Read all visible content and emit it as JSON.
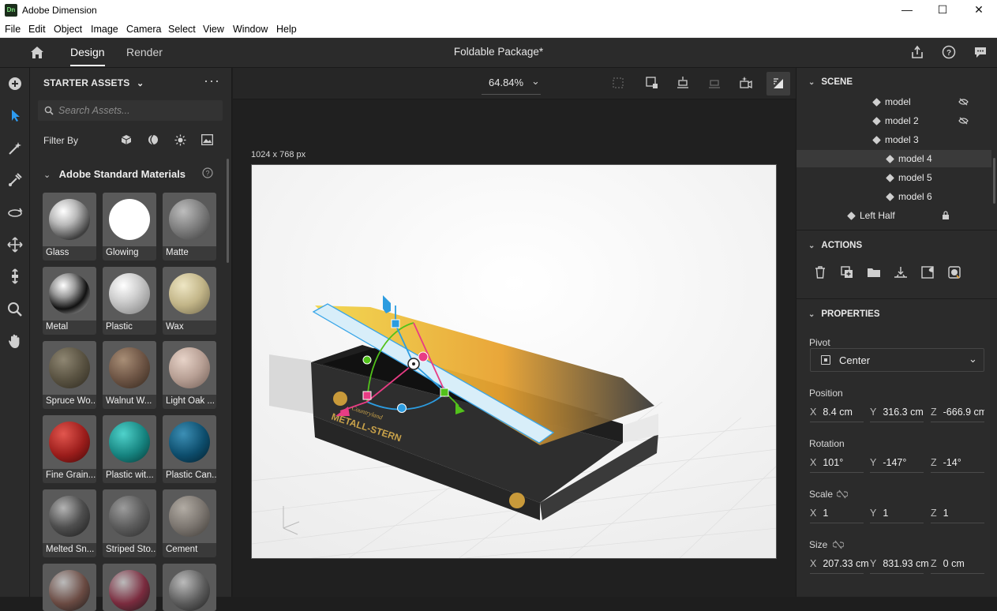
{
  "window": {
    "title": "Adobe Dimension",
    "logo": "Dn",
    "minimize": "—",
    "maximize": "☐",
    "close": "✕"
  },
  "menu": [
    "File",
    "Edit",
    "Object",
    "Image",
    "Camera",
    "Select",
    "View",
    "Window",
    "Help"
  ],
  "appbar": {
    "tab_design": "Design",
    "tab_render": "Render",
    "document_title": "Foldable Package*"
  },
  "assets": {
    "section_label": "STARTER ASSETS",
    "search_placeholder": "Search Assets...",
    "filter_label": "Filter By",
    "group_title": "Adobe Standard Materials",
    "materials": [
      {
        "label": "Glass"
      },
      {
        "label": "Glowing"
      },
      {
        "label": "Matte"
      },
      {
        "label": "Metal"
      },
      {
        "label": "Plastic"
      },
      {
        "label": "Wax"
      },
      {
        "label": "Spruce Wo..."
      },
      {
        "label": "Walnut W..."
      },
      {
        "label": "Light Oak ..."
      },
      {
        "label": "Fine Grain..."
      },
      {
        "label": "Plastic wit..."
      },
      {
        "label": "Plastic Can..."
      },
      {
        "label": "Melted Sn..."
      },
      {
        "label": "Striped Sto..."
      },
      {
        "label": "Cement"
      }
    ]
  },
  "viewport": {
    "zoom": "64.84%",
    "canvas_size": "1024 x 768 px",
    "box_brand": "Countryland",
    "box_product": "METALL-STERN"
  },
  "scene": {
    "title": "SCENE",
    "items": [
      {
        "label": "model",
        "hidden": true
      },
      {
        "label": "model 2",
        "hidden": true
      },
      {
        "label": "model 3"
      },
      {
        "label": "model 4",
        "selected": true
      },
      {
        "label": "model 5"
      },
      {
        "label": "model 6"
      },
      {
        "label": "Left Half",
        "locked": true
      }
    ]
  },
  "actions": {
    "title": "ACTIONS"
  },
  "properties": {
    "title": "PROPERTIES",
    "pivot_label": "Pivot",
    "pivot_value": "Center",
    "position_label": "Position",
    "position": {
      "x": "8.4 cm",
      "y": "316.3 cm",
      "z": "-666.9 cm"
    },
    "rotation_label": "Rotation",
    "rotation": {
      "x": "101°",
      "y": "-147°",
      "z": "-14°"
    },
    "scale_label": "Scale",
    "scale": {
      "x": "1",
      "y": "1",
      "z": "1"
    },
    "size_label": "Size",
    "size": {
      "x": "207.33 cm",
      "y": "831.93 cm",
      "z": "0 cm"
    },
    "axes": {
      "x": "X",
      "y": "Y",
      "z": "Z"
    }
  },
  "colors": {
    "accent": "#2d9bf0",
    "selection_outline": "#3aa6e8",
    "gizmo_green": "#52c21b",
    "gizmo_pink": "#e83c84",
    "gizmo_blue": "#2c9ce0"
  }
}
